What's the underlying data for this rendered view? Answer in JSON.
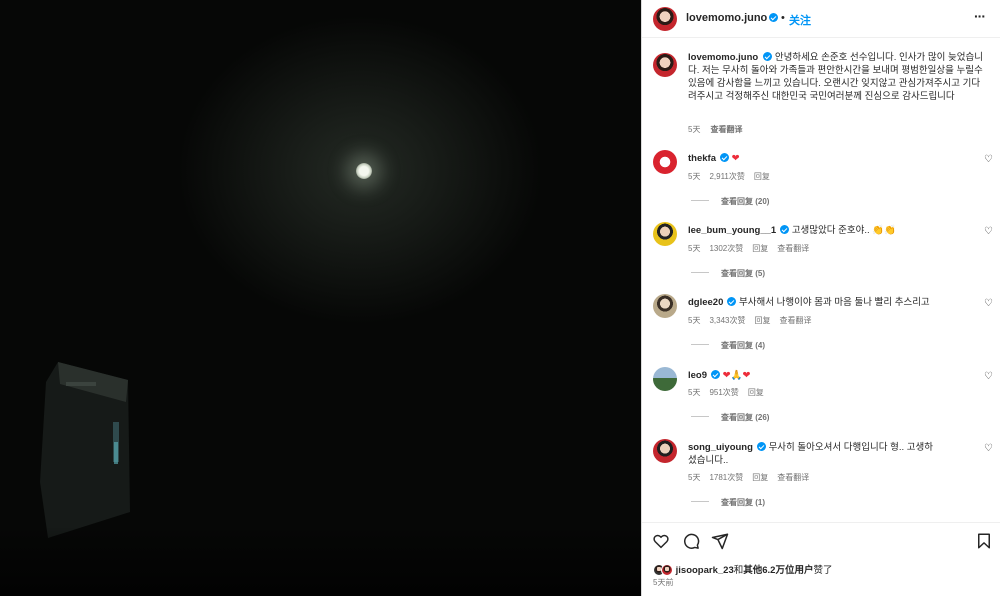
{
  "post": {
    "username": "lovemomo.juno",
    "dot": "•",
    "follow_label": "关注",
    "more_label": "···"
  },
  "caption": {
    "username": "lovemomo.juno",
    "text": "안녕하세요 손준호 선수입니다. 인사가 많이 늦었습니다. 저는 무사히 돌아와 가족들과 편안한시간을 보내며 평범한일상을 누릴수있음에 감사함을 느끼고 있습니다. 오랜시간 잊지않고 관심가져주시고 기다려주시고 걱정해주신 대한민국 국민여러분께 진심으로 감사드립니다",
    "time": "5天",
    "translate_label": "查看翻译"
  },
  "comments": [
    {
      "username": "thekfa",
      "text": "",
      "emoji": "❤",
      "time": "5天",
      "likes": "2,911次赞",
      "reply_label": "回复",
      "translate_label": "",
      "view_replies": "查看回复 (20)",
      "avatar_color": "#d9232e"
    },
    {
      "username": "lee_bum_young__1",
      "text": "고생많았다 준호야.. ",
      "emoji": "👏👏",
      "time": "5天",
      "likes": "1302次赞",
      "reply_label": "回复",
      "translate_label": "查看翻译",
      "view_replies": "查看回复 (5)",
      "avatar_color": "#e8c21a"
    },
    {
      "username": "dglee20",
      "text": "부사해서 나행이야 몸과 마음 둘나 빨리 추스리고",
      "emoji": "",
      "time": "5天",
      "likes": "3,343次赞",
      "reply_label": "回复",
      "translate_label": "查看翻译",
      "view_replies": "查看回复 (4)",
      "avatar_color": "#b9a98a"
    },
    {
      "username": "leo9",
      "text": "",
      "emoji": "❤🙏❤",
      "time": "5天",
      "likes": "951次赞",
      "reply_label": "回复",
      "translate_label": "",
      "view_replies": "查看回复 (26)",
      "avatar_color": "#4f7fae"
    },
    {
      "username": "song_uiyoung",
      "text": "무사히 돌아오셔서 다행입니다 형.. 고생하셨습니다..",
      "emoji": "",
      "time": "5天",
      "likes": "1781次赞",
      "reply_label": "回复",
      "translate_label": "查看翻译",
      "view_replies": "查看回复 (1)",
      "avatar_color": "#2b2b2b"
    }
  ],
  "likes_summary": {
    "liker": "jisoopark_23",
    "and": "和",
    "others": "其他6.2万位用户",
    "suffix": "赞了"
  },
  "timestamp": "5天前",
  "icons": {
    "like": "heart-icon",
    "comment": "comment-icon",
    "share": "share-icon",
    "save": "bookmark-icon"
  }
}
